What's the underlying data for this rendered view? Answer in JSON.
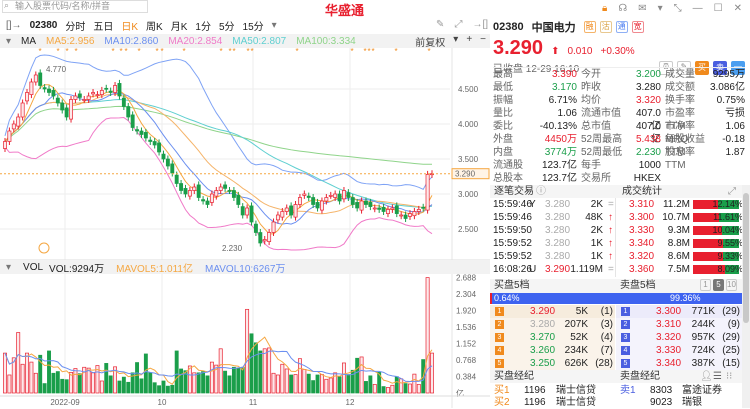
{
  "search": {
    "placeholder": "输入股票代码/名称/拼音"
  },
  "logo": "华盛通",
  "toolbar": {
    "code": "02380",
    "items": [
      "分时",
      "五日",
      "日K",
      "周K",
      "月K",
      "1分",
      "5分",
      "15分"
    ],
    "selected": "日K"
  },
  "ma": {
    "label": "MA",
    "ma5": "MA5:2.956",
    "ma10": "MA10:2.860",
    "ma20": "MA20:2.854",
    "ma50": "MA50:2.807",
    "ma100": "MA100:3.334",
    "adjust": "前复权"
  },
  "colors": {
    "ma5": "#f5a742",
    "ma10": "#6b8ff0",
    "ma20": "#f07ac8",
    "ma50": "#5ecfd0",
    "ma100": "#8fd48a",
    "up": "#e8202f",
    "down": "#1a9e4a"
  },
  "chart_data": {
    "type": "candlestick",
    "price_ticks": [
      "4.500",
      "4.000",
      "3.500",
      "3.000",
      "2.500"
    ],
    "price_range": [
      2.1,
      4.95
    ],
    "high_label": "4.770",
    "low_label": "2.230",
    "last_label": "3.290",
    "last": 3.29,
    "closes": [
      3.75,
      3.9,
      4.0,
      4.1,
      4.3,
      4.45,
      4.6,
      4.7,
      4.55,
      4.5,
      4.45,
      4.4,
      4.3,
      4.2,
      4.1,
      4.35,
      4.4,
      4.38,
      4.35,
      4.4,
      4.45,
      4.42,
      4.48,
      4.5,
      4.45,
      4.55,
      4.4,
      4.25,
      4.1,
      3.95,
      3.9,
      3.85,
      3.8,
      3.75,
      3.7,
      3.6,
      3.5,
      3.4,
      3.3,
      3.15,
      3.05,
      3.0,
      3.05,
      3.1,
      2.95,
      2.9,
      2.85,
      3.0,
      3.05,
      3.1,
      3.08,
      3.05,
      2.95,
      2.85,
      2.7,
      2.8,
      2.6,
      2.45,
      2.3,
      2.35,
      2.45,
      2.6,
      2.7,
      2.75,
      2.8,
      2.7,
      2.85,
      2.95,
      3.0,
      2.95,
      2.85,
      2.8,
      2.9,
      2.95,
      2.98,
      3.0,
      2.9,
      3.05,
      2.95,
      2.85,
      2.8,
      2.9,
      2.85,
      2.82,
      2.8,
      2.78,
      2.75,
      2.78,
      2.8,
      2.72,
      2.7,
      2.65,
      2.72,
      2.75,
      2.78,
      2.8,
      3.28,
      3.29
    ],
    "volumes": [
      0.93,
      0.42,
      0.82,
      1.41,
      0.67,
      0.93,
      0.72,
      0.46,
      0.88,
      0.22,
      0.98,
      0.46,
      0.5,
      0.32,
      0.31,
      0.48,
      0.57,
      0.45,
      0.6,
      0.58,
      0.47,
      0.64,
      0.28,
      0.69,
      0.4,
      0.61,
      0.28,
      0.37,
      0.25,
      0.47,
      0.71,
      0.33,
      0.91,
      0.47,
      0.24,
      0.17,
      0.28,
      0.16,
      0.18,
      0.98,
      0.56,
      0.52,
      0.63,
      0.47,
      0.47,
      0.5,
      0.4,
      0.72,
      0.65,
      1.03,
      0.51,
      0.4,
      0.6,
      0.58,
      0.6,
      1.95,
      1.38,
      1.17,
      0.98,
      1.03,
      1.05,
      0.46,
      0.42,
      0.67,
      0.56,
      0.42,
      0.43,
      0.8,
      0.55,
      0.44,
      0.29,
      0.42,
      0.43,
      0.32,
      0.35,
      0.47,
      0.38,
      0.7,
      0.43,
      0.53,
      0.81,
      0.84,
      0.27,
      0.4,
      0.2,
      0.48,
      0.15,
      0.13,
      0.18,
      0.38,
      0.33,
      0.22,
      0.21,
      0.44,
      0.2,
      0.78,
      2.69,
      0.93
    ],
    "vol_ticks": [
      "2.688",
      "2.304",
      "1.920",
      "1.536",
      "1.152",
      "0.768",
      "0.384",
      "亿"
    ],
    "vol_max": 2.75,
    "x_labels": [
      "2022-09",
      "10",
      "11",
      "12"
    ]
  },
  "vol": {
    "label": "VOL",
    "vol": "VOL:9294万",
    "mavol5": "MAVOL5:1.011亿",
    "mavol10": "MAVOL10:6267万"
  },
  "quote": {
    "code": "02380",
    "name": "中国电力",
    "tags": [
      "融",
      "沽",
      "通",
      "宽"
    ],
    "price": "3.290",
    "change": "0.010",
    "pct": "+0.30%",
    "status": "已收盘 12-29 16:10",
    "buy": "买",
    "sell": "卖"
  },
  "stats": [
    [
      [
        "最高",
        "3.390"
      ],
      [
        "今开",
        "3.200"
      ],
      [
        "成交量",
        "9295万"
      ]
    ],
    [
      [
        "最低",
        "3.170"
      ],
      [
        "昨收",
        "3.280"
      ],
      [
        "成交额",
        "3.086亿"
      ]
    ],
    [
      [
        "振幅",
        "6.71%"
      ],
      [
        "均价",
        "3.320"
      ],
      [
        "换手率",
        "0.75%"
      ]
    ],
    [
      [
        "量比",
        "1.06"
      ],
      [
        "流通市值",
        "407.0亿"
      ],
      [
        "市盈率TTM",
        "亏损"
      ]
    ],
    [
      [
        "委比",
        "-40.13%"
      ],
      [
        "总市值",
        "407.0亿"
      ],
      [
        "市净率MRQ",
        "1.06"
      ]
    ],
    [
      [
        "外盘",
        "4450万"
      ],
      [
        "52周最高",
        "5.438"
      ],
      [
        "每股收益TTM",
        "-0.18"
      ]
    ],
    [
      [
        "内盘",
        "3774万"
      ],
      [
        "52周最低",
        "2.230"
      ],
      [
        "股息率TTM",
        "1.87"
      ]
    ],
    [
      [
        "流通股",
        "123.7亿"
      ],
      [
        "每手",
        "1000"
      ],
      [
        "",
        ""
      ]
    ],
    [
      [
        "总股本",
        "123.7亿"
      ],
      [
        "交易所",
        "HKEX"
      ],
      [
        "",
        ""
      ]
    ]
  ],
  "trades_title": "逐笔交易",
  "stats_title": "成交统计",
  "trades": [
    [
      "15:59:46",
      "Y",
      "3.280",
      "2K",
      "="
    ],
    [
      "15:59:46",
      "",
      "3.280",
      "48K",
      "↑"
    ],
    [
      "15:59:50",
      "",
      "3.280",
      "2K",
      "↑"
    ],
    [
      "15:59:52",
      "",
      "3.280",
      "1K",
      "↑"
    ],
    [
      "15:59:52",
      "",
      "3.280",
      "1K",
      "↑"
    ],
    [
      "16:08:26",
      "U",
      "3.290",
      "1.119M",
      "="
    ]
  ],
  "volstats": [
    [
      "3.310",
      "11.2M",
      "12.14%",
      12.14
    ],
    [
      "3.300",
      "10.7M",
      "11.61%",
      11.61
    ],
    [
      "3.330",
      "9.3M",
      "10.04%",
      10.04
    ],
    [
      "3.340",
      "8.8M",
      "9.55%",
      9.55
    ],
    [
      "3.320",
      "8.6M",
      "9.33%",
      9.33
    ],
    [
      "3.360",
      "7.5M",
      "8.09%",
      8.09
    ]
  ],
  "book": {
    "bid_title": "买盘5档",
    "ask_title": "卖盘5档",
    "levels": [
      "1",
      "5",
      "10"
    ],
    "bid_pct": "0.64%",
    "ask_pct": "99.36%",
    "bid_frac": 0.0064,
    "bids": [
      [
        "1",
        "3.290",
        "5K",
        "(1)"
      ],
      [
        "2",
        "3.280",
        "207K",
        "(3)"
      ],
      [
        "3",
        "3.270",
        "52K",
        "(4)"
      ],
      [
        "4",
        "3.260",
        "234K",
        "(7)"
      ],
      [
        "5",
        "3.250",
        "626K",
        "(28)"
      ]
    ],
    "asks": [
      [
        "1",
        "3.300",
        "771K",
        "(29)"
      ],
      [
        "2",
        "3.310",
        "244K",
        "(9)"
      ],
      [
        "3",
        "3.320",
        "957K",
        "(29)"
      ],
      [
        "4",
        "3.330",
        "724K",
        "(25)"
      ],
      [
        "5",
        "3.340",
        "387K",
        "(15)"
      ]
    ]
  },
  "brokers": {
    "buy_title": "买盘经纪",
    "sell_title": "卖盘经纪",
    "buy": [
      [
        "买1",
        "1196",
        "瑞士信贷"
      ],
      [
        "买2",
        "1196",
        "瑞士信贷"
      ]
    ],
    "sell": [
      [
        "卖1",
        "8303",
        "富途证券"
      ],
      [
        "",
        "9023",
        "瑞银"
      ]
    ]
  }
}
